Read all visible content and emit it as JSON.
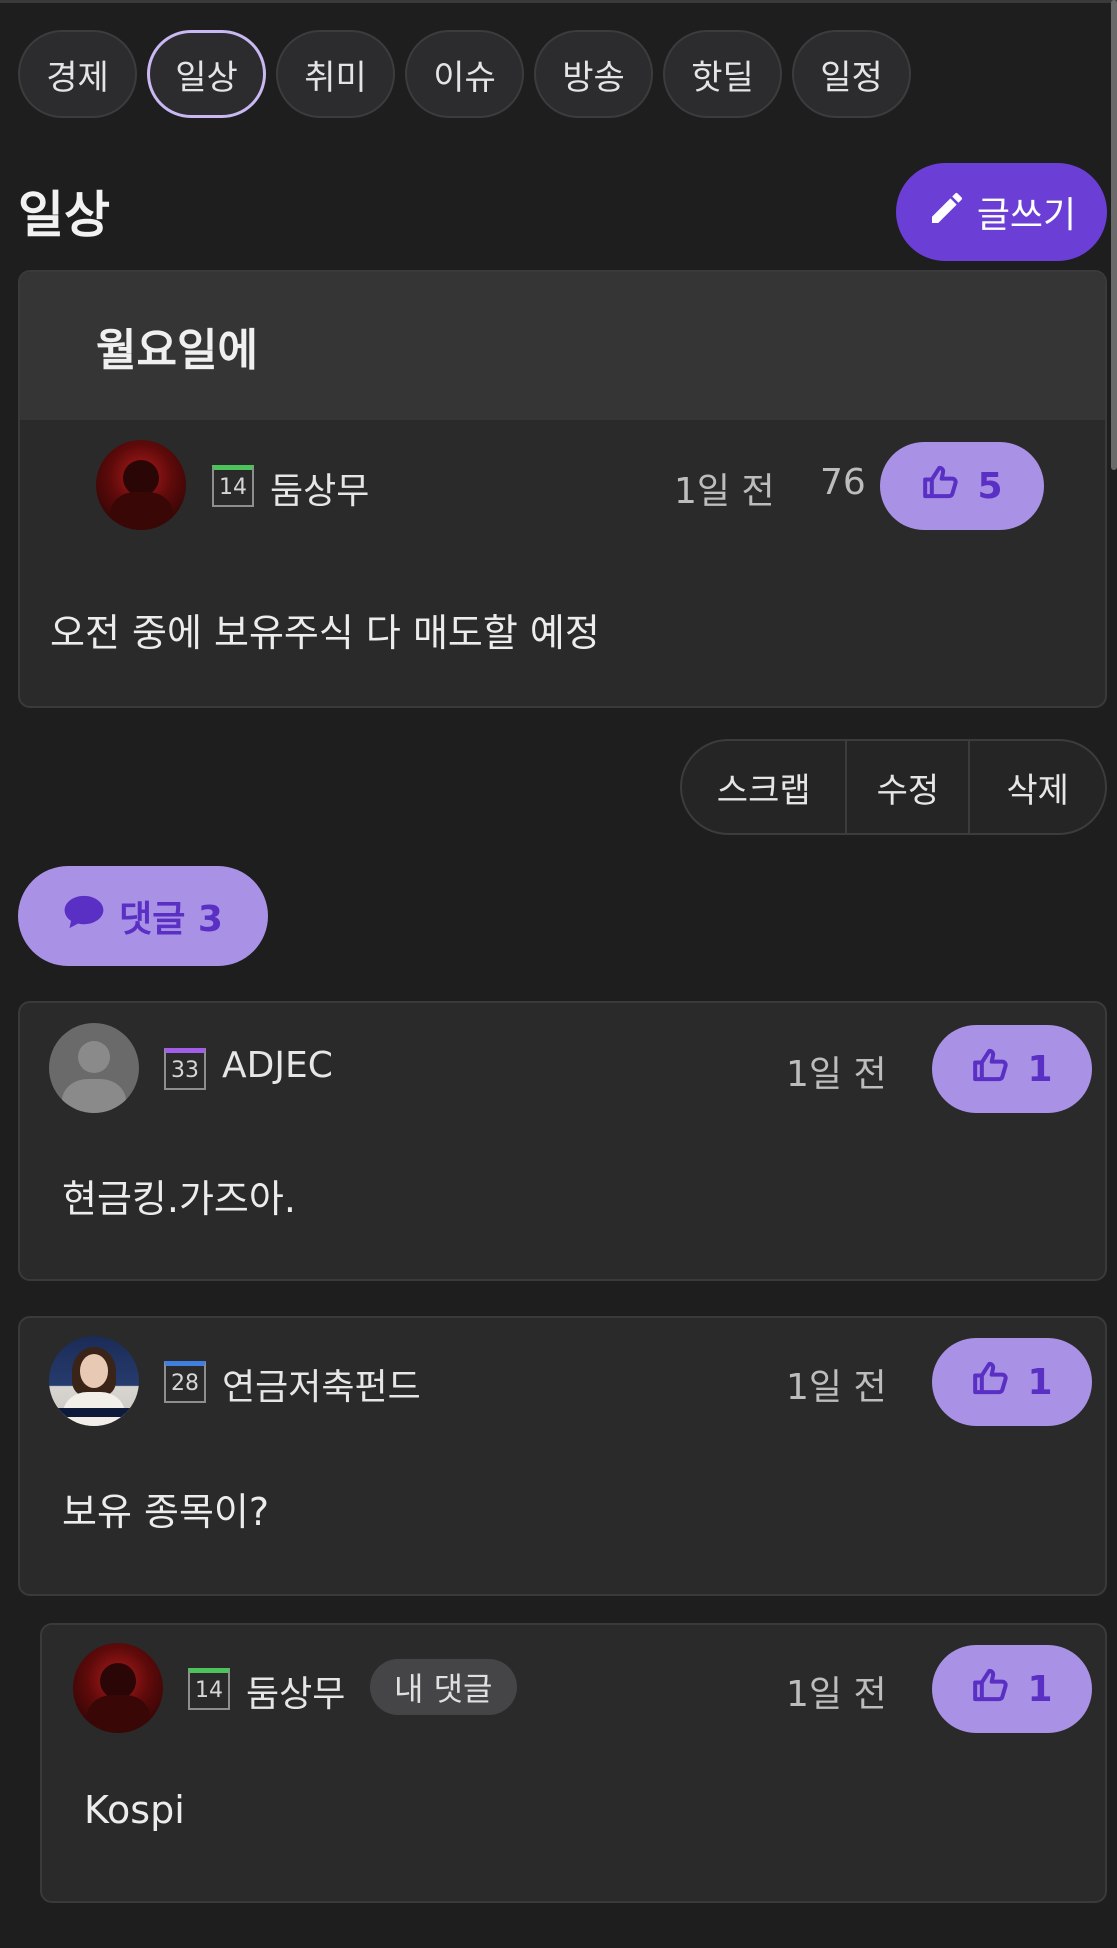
{
  "categories": [
    {
      "label": "경제",
      "active": false
    },
    {
      "label": "일상",
      "active": true
    },
    {
      "label": "취미",
      "active": false
    },
    {
      "label": "이슈",
      "active": false
    },
    {
      "label": "방송",
      "active": false
    },
    {
      "label": "핫딜",
      "active": false
    },
    {
      "label": "일정",
      "active": false
    }
  ],
  "page": {
    "title": "일상",
    "write_label": "글쓰기"
  },
  "post": {
    "title": "월요일에",
    "author": {
      "level": "14",
      "nickname": "둠상무"
    },
    "time": "1일 전",
    "views": "76",
    "likes": "5",
    "body": "오전 중에 보유주식 다 매도할 예정"
  },
  "actions": {
    "scrap": "스크랩",
    "edit": "수정",
    "delete": "삭제"
  },
  "comments_header": {
    "label": "댓글 3"
  },
  "comments": [
    {
      "level": "33",
      "nickname": "ADJEC",
      "time": "1일 전",
      "likes": "1",
      "text": "현금킹.가즈아."
    },
    {
      "level": "28",
      "nickname": "연금저축펀드",
      "time": "1일 전",
      "likes": "1",
      "text": "보유 종목이?"
    },
    {
      "level": "14",
      "nickname": "둠상무",
      "badge": "내 댓글",
      "time": "1일 전",
      "likes": "1",
      "text": "Kospi"
    }
  ],
  "colors": {
    "accent": "#6b3ed6",
    "accent_light": "#a992e6",
    "background": "#1e1e1f",
    "card": "#2a2a2b"
  },
  "icons": [
    "pencil-icon",
    "thumbs-up-icon",
    "speech-bubble-icon"
  ]
}
